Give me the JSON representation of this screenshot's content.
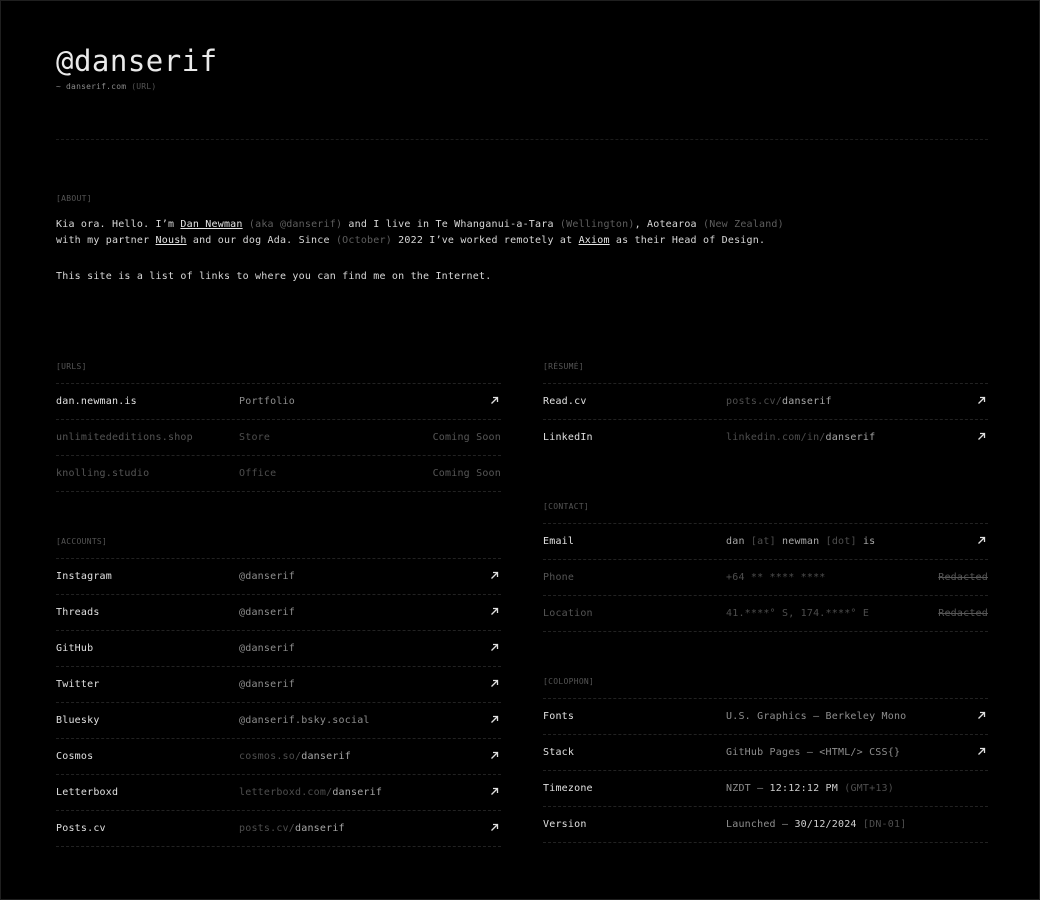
{
  "header": {
    "handle": "@danserif",
    "sub_prefix": "~ danserif.com",
    "sub_note": "(URL)"
  },
  "about": {
    "label": "[ABOUT]",
    "s1": "Kia ora. Hello. I’m ",
    "name_link": "Dan Newman",
    "aka": "(aka @danserif)",
    "s2": " and I live in Te Whanganui-a-Tara ",
    "city_note": "(Wellington)",
    "s3": ", Aotearoa ",
    "country_note": "(New Zealand)",
    "s4": "with my partner ",
    "partner_link": "Noush",
    "s5": " and our dog Ada. Since ",
    "month_note": "(October)",
    "s6": " 2022 I’ve worked remotely at ",
    "company_link": "Axiom",
    "s7": " as their Head of Design.",
    "p2": "This site is a list of links to where you can find me on the Internet."
  },
  "urls": {
    "label": "[URLS]",
    "rows": [
      {
        "name": "dan.newman.is",
        "desc": "Portfolio",
        "status": ""
      },
      {
        "name": "unlimitededitions.shop",
        "desc": "Store",
        "status": "Coming Soon"
      },
      {
        "name": "knolling.studio",
        "desc": "Office",
        "status": "Coming Soon"
      }
    ]
  },
  "accounts": {
    "label": "[ACCOUNTS]",
    "rows": [
      {
        "name": "Instagram",
        "handle": "@danserif"
      },
      {
        "name": "Threads",
        "handle": "@danserif"
      },
      {
        "name": "GitHub",
        "handle": "@danserif"
      },
      {
        "name": "Twitter",
        "handle": "@danserif"
      },
      {
        "name": "Bluesky",
        "handle": "@danserif.bsky.social"
      },
      {
        "name": "Cosmos",
        "domain": "cosmos.so/",
        "user": "danserif"
      },
      {
        "name": "Letterboxd",
        "domain": "letterboxd.com/",
        "user": "danserif"
      },
      {
        "name": "Posts.cv",
        "domain": "posts.cv/",
        "user": "danserif"
      }
    ]
  },
  "resume": {
    "label": "[RÉSUMÉ]",
    "rows": [
      {
        "name": "Read.cv",
        "domain": "posts.cv/",
        "user": "danserif"
      },
      {
        "name": "LinkedIn",
        "domain": "linkedin.com/in/",
        "user": "danserif"
      }
    ]
  },
  "contact": {
    "label": "[CONTACT]",
    "email": {
      "name": "Email",
      "a": "dan",
      "b": "[at]",
      "c": "newman",
      "d": "[dot]",
      "e": "is"
    },
    "phone": {
      "name": "Phone",
      "value": "+64 ** **** ****",
      "status": "Redacted"
    },
    "location": {
      "name": "Location",
      "value": "41.****° S, 174.****° E",
      "status": "Redacted"
    }
  },
  "colophon": {
    "label": "[COLOPHON]",
    "fonts": {
      "name": "Fonts",
      "value": "U.S. Graphics — Berkeley Mono"
    },
    "stack": {
      "name": "Stack",
      "value": "GitHub Pages — <HTML/> CSS{}"
    },
    "timezone": {
      "name": "Timezone",
      "prefix": "NZDT — ",
      "time": "12:12:12 PM",
      "note": "(GMT+13)"
    },
    "version": {
      "name": "Version",
      "prefix": "Launched — ",
      "date": "30/12/2024",
      "note": "[DN-01]"
    }
  },
  "icons": {
    "external": "arrow-up-right-icon"
  }
}
